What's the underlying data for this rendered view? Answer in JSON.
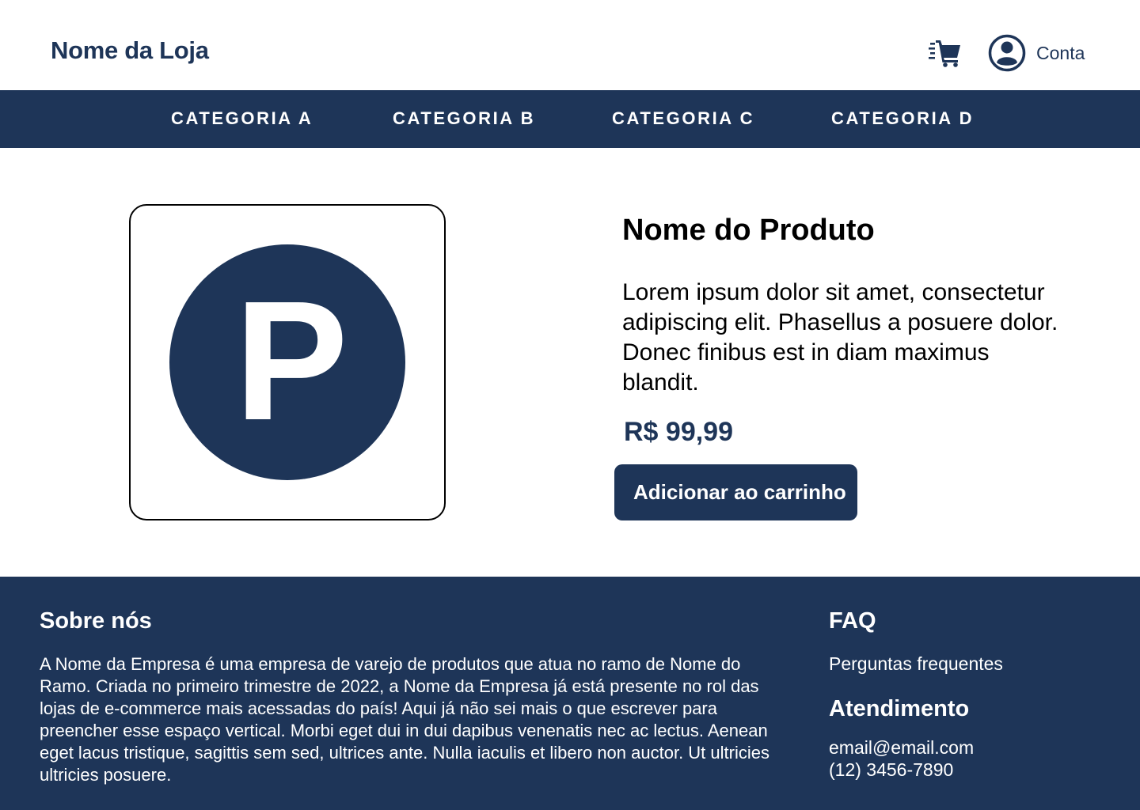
{
  "header": {
    "store_name": "Nome da Loja",
    "cart_icon": "cart-icon",
    "account_icon": "user-circle-icon",
    "account_label": "Conta"
  },
  "nav": {
    "items": [
      {
        "label": "CATEGORIA A"
      },
      {
        "label": "CATEGORIA B"
      },
      {
        "label": "CATEGORIA C"
      },
      {
        "label": "CATEGORIA D"
      }
    ]
  },
  "product": {
    "image_icon": "product-placeholder-icon",
    "image_letter": "P",
    "name": "Nome do Produto",
    "description": "Lorem ipsum dolor sit amet, consectetur adipiscing elit. Phasellus a posuere dolor. Donec finibus est in diam maximus blandit.",
    "price": "R$ 99,99",
    "add_to_cart_label": "Adicionar ao carrinho"
  },
  "footer": {
    "about": {
      "title": "Sobre nós",
      "text": "A Nome da Empresa é uma empresa de varejo de produtos que atua no ramo de Nome do Ramo. Criada no primeiro trimestre de 2022, a Nome da Empresa já está presente no rol das  lojas de e-commerce mais acessadas do país! Aqui já não sei mais o que escrever para preencher esse espaço vertical. Morbi eget dui in dui dapibus venenatis nec ac lectus. Aenean eget lacus tristique, sagittis sem sed, ultrices ante. Nulla iaculis et libero non auctor. Ut ultricies ultricies posuere."
    },
    "faq": {
      "title": "FAQ",
      "link": "Perguntas frequentes"
    },
    "support": {
      "title": "Atendimento",
      "email": "email@email.com",
      "phone": "(12) 3456-7890"
    }
  },
  "colors": {
    "brand": "#1e3558",
    "background": "#ffffff",
    "text": "#000000"
  }
}
